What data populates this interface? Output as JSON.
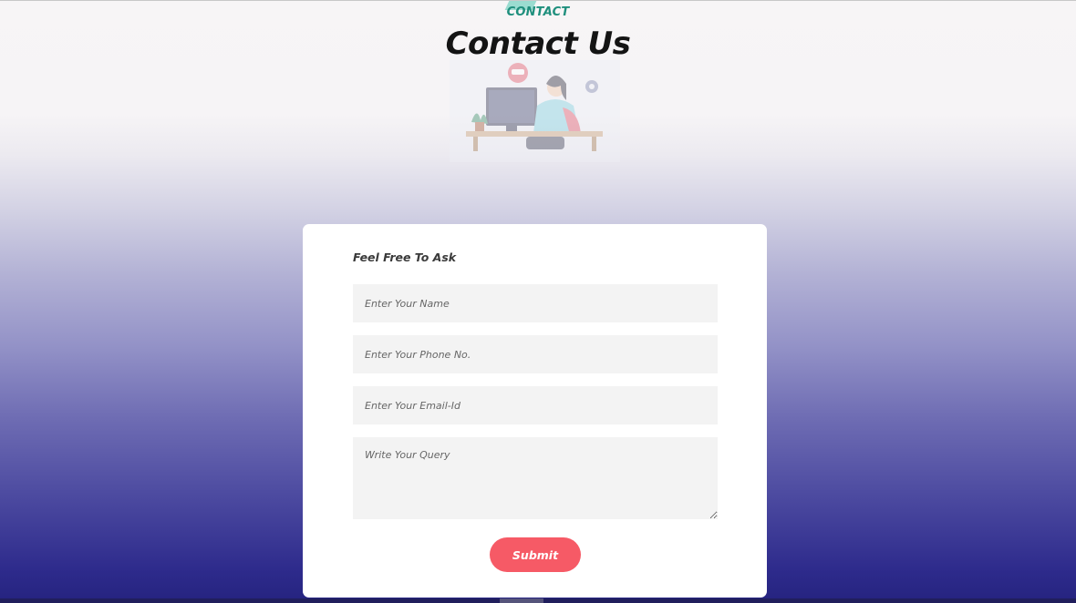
{
  "header": {
    "kicker": "CONTACT",
    "title": "Contact Us",
    "illustration_icon": "support-agent-illustration"
  },
  "form": {
    "heading": "Feel Free To Ask",
    "name_placeholder": "Enter Your Name",
    "phone_placeholder": "Enter Your Phone No.",
    "email_placeholder": "Enter Your Email-Id",
    "query_placeholder": "Write Your Query",
    "submit_label": "Submit"
  },
  "colors": {
    "accent_teal": "#1f8f7d",
    "submit_button": "#f65a66",
    "gradient_bottom": "#25237f",
    "card_background": "#ffffff",
    "field_background": "#f3f3f3"
  }
}
